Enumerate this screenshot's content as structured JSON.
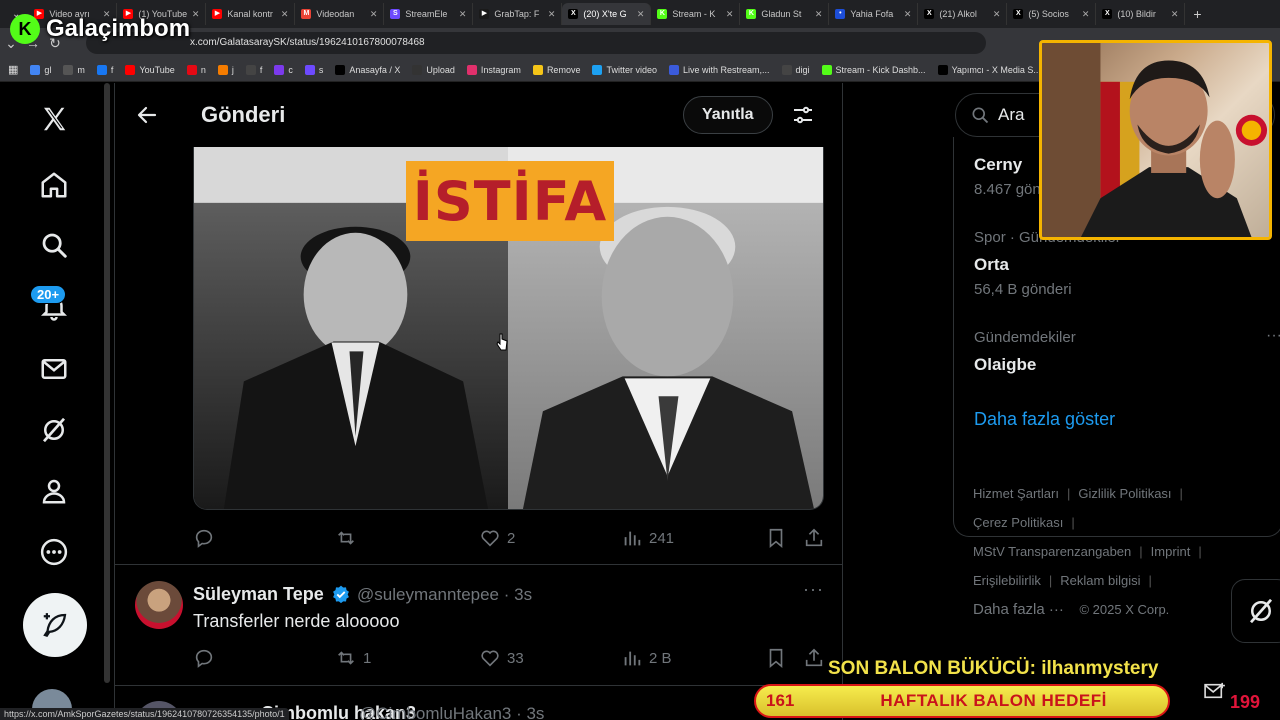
{
  "brand": {
    "name": "Galaçimbom",
    "logo_letter": "K"
  },
  "browser": {
    "tabs": [
      {
        "label": "Video ayrı",
        "color": "#ff0000",
        "glyph": "▶"
      },
      {
        "label": "(1) YouTube",
        "color": "#ff0000",
        "glyph": "▶"
      },
      {
        "label": "Kanal kontr",
        "color": "#ff0000",
        "glyph": "▶"
      },
      {
        "label": "Videodan",
        "color": "#ea4335",
        "glyph": "M"
      },
      {
        "label": "StreamEle",
        "color": "#6d4aff",
        "glyph": "S"
      },
      {
        "label": "GrabTap: F",
        "color": "#1a1a1a",
        "glyph": "▶"
      },
      {
        "label": "(20) X'te G",
        "color": "#000000",
        "glyph": "X",
        "active": true
      },
      {
        "label": "Stream - K",
        "color": "#53fc18",
        "glyph": "K"
      },
      {
        "label": "Gladun St",
        "color": "#53fc18",
        "glyph": "K"
      },
      {
        "label": "Yahia Fofa",
        "color": "#1d4ed8",
        "glyph": "•"
      },
      {
        "label": "(21) Alkol",
        "color": "#000000",
        "glyph": "X"
      },
      {
        "label": "(5) Socios",
        "color": "#000000",
        "glyph": "X"
      },
      {
        "label": "(10) Bildir",
        "color": "#000000",
        "glyph": "X"
      }
    ],
    "new_tab": "+",
    "url": "x.com/GalatasaraySK/status/1962410167800078468",
    "bookmarks": [
      {
        "label": "gl",
        "color": "#4285f4"
      },
      {
        "label": "m",
        "color": "#555555"
      },
      {
        "label": "f",
        "color": "#1877f2"
      },
      {
        "label": "YouTube",
        "color": "#ff0000"
      },
      {
        "label": "n",
        "color": "#e50914"
      },
      {
        "label": "j",
        "color": "#f57c00"
      },
      {
        "label": "f",
        "color": "#444444"
      },
      {
        "label": "c",
        "color": "#7c3aed"
      },
      {
        "label": "s",
        "color": "#6d4aff"
      },
      {
        "label": "Anasayfa / X",
        "color": "#000000"
      },
      {
        "label": "Upload",
        "color": "#333333"
      },
      {
        "label": "Instagram",
        "color": "#e1306c"
      },
      {
        "label": "Remove",
        "color": "#f5c518"
      },
      {
        "label": "Twitter video",
        "color": "#1da1f2"
      },
      {
        "label": "Live with Restream,...",
        "color": "#3b5bdb"
      },
      {
        "label": "digi",
        "color": "#444444"
      },
      {
        "label": "Stream - Kick Dashb...",
        "color": "#53fc18"
      },
      {
        "label": "Yapımcı - X Media S...",
        "color": "#000000"
      }
    ]
  },
  "nav": {
    "notifications_badge": "20+"
  },
  "header": {
    "title": "Gönderi",
    "reply_label": "Yanıtla"
  },
  "post": {
    "image_banner": "İSTİFA",
    "stats": {
      "reply": "",
      "repost": "",
      "likes": "2",
      "views": "241"
    }
  },
  "replies": [
    {
      "name": "Süleyman Tepe",
      "handle": "@suleymanntepee · 3s",
      "text": "Transferler nerde alooooo",
      "stats": {
        "reply": "",
        "repost": "1",
        "likes": "33",
        "views": "2 B"
      }
    },
    {
      "name": "Cimbomlu hakan3",
      "handle": "@CimbomluHakan3 · 3s"
    }
  ],
  "sidebar": {
    "search_placeholder": "Ara",
    "trends": [
      {
        "meta": "",
        "name": "Cerny",
        "count": "8.467 gönderi"
      },
      {
        "meta": "Spor · Gündemdekiler",
        "name": "Orta",
        "count": "56,4 B gönderi"
      },
      {
        "meta": "Gündemdekiler",
        "name": "Olaigbe",
        "count": ""
      }
    ],
    "show_more": "Daha fazla göster",
    "footer": {
      "links": [
        "Hizmet Şartları",
        "Gizlilik Politikası",
        "Çerez Politikası",
        "MStV Transparenzangaben",
        "Imprint",
        "Erişilebilirlik",
        "Reklam bilgisi"
      ],
      "more": "Daha fazla ···",
      "copyright": "© 2025 X Corp."
    }
  },
  "overlay": {
    "balon_title": "SON BALON BÜKÜCÜ: ilhanmystery",
    "balon_current": "161",
    "balon_label": "HAFTALIK BALON HEDEFİ",
    "balon_goal": "199",
    "balon_progress": 0.81
  },
  "status_url": "https://x.com/AmkSporGazetes/status/1962410780726354135/photo/1"
}
